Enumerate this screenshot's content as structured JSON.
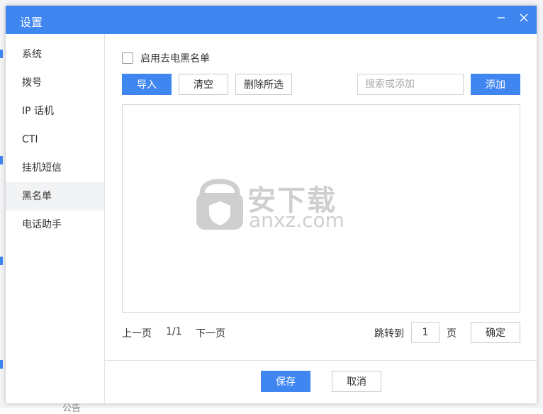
{
  "dialog": {
    "title": "设置",
    "colors": {
      "accent": "#3f86f0",
      "sidebar_active": "#f2f3f5",
      "border": "#d9d9d9"
    }
  },
  "sidebar": {
    "items": [
      {
        "label": "系统"
      },
      {
        "label": "拨号"
      },
      {
        "label": "IP 话机"
      },
      {
        "label": "CTI"
      },
      {
        "label": "挂机短信"
      },
      {
        "label": "黑名单",
        "active": true
      },
      {
        "label": "电话助手"
      }
    ]
  },
  "blacklist": {
    "enable_label": "启用去电黑名单",
    "enabled": false,
    "import_label": "导入",
    "clear_label": "清空",
    "delete_selected_label": "删除所选",
    "search_placeholder": "搜索或添加",
    "search_value": "",
    "add_label": "添加"
  },
  "watermark": {
    "cn": "安下载",
    "en": "anxz.com"
  },
  "pager": {
    "prev_label": "上一页",
    "page_info": "1/1",
    "next_label": "下一页",
    "jump_label": "跳转到",
    "jump_value": "1",
    "page_unit": "页",
    "confirm_label": "确定"
  },
  "footer": {
    "save_label": "保存",
    "cancel_label": "取消"
  },
  "background": {
    "footer_text": "公告"
  }
}
